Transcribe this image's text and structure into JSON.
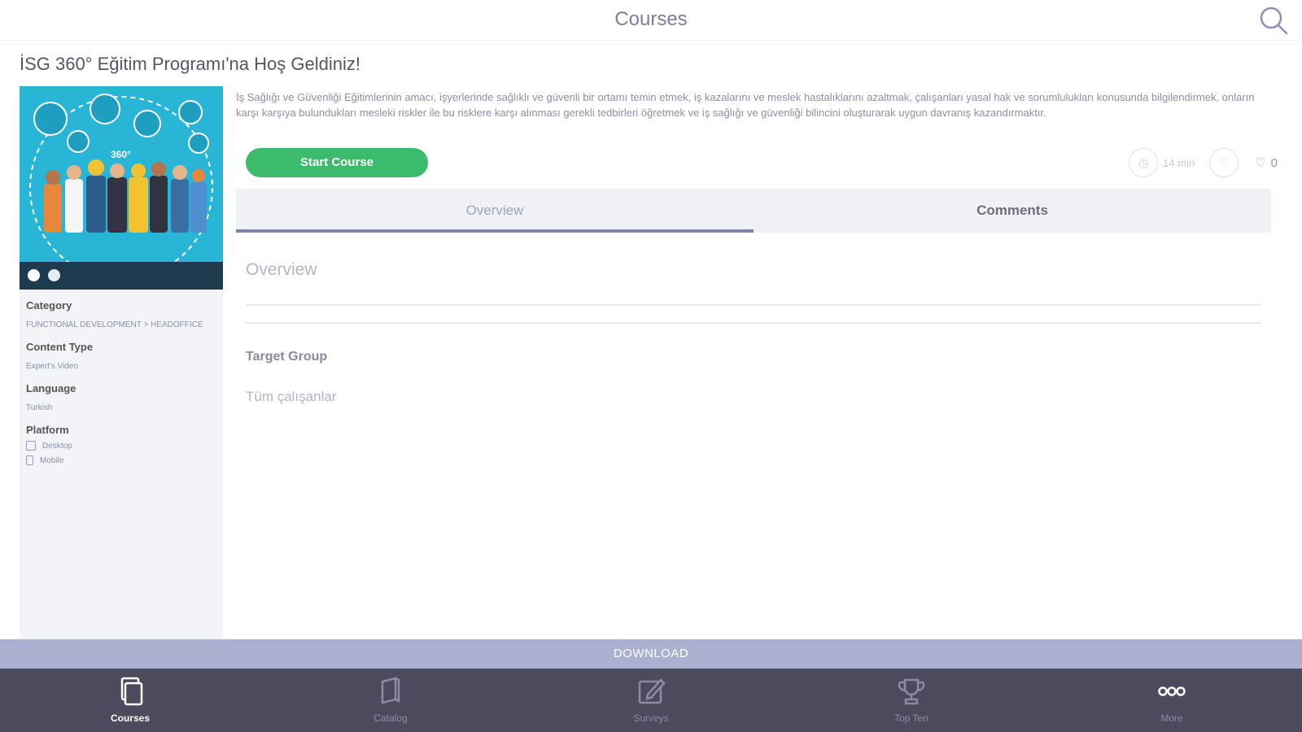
{
  "header": {
    "title": "Courses",
    "search_icon": "search-icon"
  },
  "course": {
    "title": "İSG 360° Eğitim Programı'na Hoş Geldiniz!",
    "description": "İş Sağlığı ve Güvenliği Eğitimlerinin amacı, işyerlerinde sağlıklı ve güvenli bir ortamı temin etmek, iş kazalarını ve meslek hastalıklarını azaltmak, çalışanları yasal hak ve sorumlulukları konusunda bilgilendirmek, onların karşı karşıya bulundukları mesleki riskler ile bu risklere karşı alınması gerekli tedbirleri öğretmek ve iş sağlığı ve güvenliği bilincini oluşturarak uygun davranış kazandırmaktır.",
    "start_button": "Start Course",
    "duration": "14 min",
    "like_count": "0"
  },
  "sidebar": {
    "category_label": "Category",
    "category_value": "FUNCTIONAL DEVELOPMENT > HEADOFFICE",
    "content_type_label": "Content Type",
    "content_type_value": "Expert's Video",
    "language_label": "Language",
    "language_value": "Turkish",
    "platform_label": "Platform",
    "platforms": [
      "Desktop",
      "Mobile"
    ]
  },
  "tabs": [
    {
      "label": "Overview",
      "active": true
    },
    {
      "label": "Comments",
      "active": false
    }
  ],
  "overview": {
    "heading": "Overview",
    "target_group_label": "Target Group",
    "target_group_value": "Tüm çalışanlar"
  },
  "download_label": "DOWNLOAD",
  "tabbar": [
    {
      "label": "Courses",
      "icon": "courses-icon",
      "active": true
    },
    {
      "label": "Catalog",
      "icon": "catalog-icon",
      "active": false
    },
    {
      "label": "Surveys",
      "icon": "survey-icon",
      "active": false
    },
    {
      "label": "Top Ten",
      "icon": "trophy-icon",
      "active": false
    },
    {
      "label": "More",
      "icon": "more-icon",
      "active": false
    }
  ],
  "colors": {
    "accent": "#7e84ac",
    "start": "#3dbb6c",
    "tabbar": "#4c4a5d",
    "download": "#aab0cf"
  }
}
